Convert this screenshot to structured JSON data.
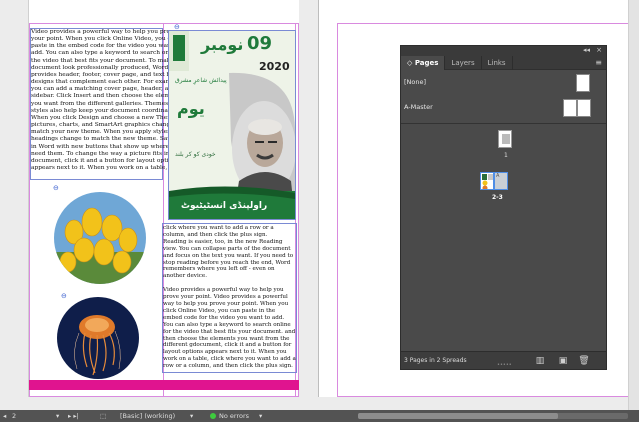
{
  "document": {
    "column1_text": "Video provides a powerful way to help you prove your point. When you click Online Video, you can paste in the embed code for the video you want to add. You can also type a keyword to search online for the video that best fits your document. To make your document look professionally produced, Word provides header, footer, cover page, and text box designs that complement each other. For example, you can add a matching cover page, header, and sidebar. Click Insert and then choose the elements you want from the different galleries. Themes and styles also help keep your document coordinated. When you click Design and choose a new Theme, the pictures, charts, and SmartArt graphics change to match your new theme. When you apply styles, your headings change to match the new theme. Save time in Word with new buttons that show up where you need them. To change the way a picture fits in your document, click it and a button for layout options appears next to it. When you work on a table,",
    "column2_text_1": "click where you want to add a row or a column, and then click the plus sign.",
    "column2_text_2": "Reading is easier, too, in the new Reading view. You can collapse parts of the document and focus on the text you want. If you need to stop reading before you reach the end, Word remembers where you left off - even on another device.",
    "column2_text_3": "Video provides a powerful way to help you prove your point. Video provides a powerful way to help you prove your point. When you click Online Video, you can paste in the embed code for the video you want to add. You can also type a keyword to search online for the video that best fits your document. and then choose the elements you want from the different gdocument, click it and a button for layout options appears next to it. When you work on a table, click where you want to add a row or a column, and then click the plus sign."
  },
  "poster": {
    "date_number": "09",
    "month_urdu": "نومبر",
    "year": "2020",
    "subtitle_urdu": "یوم",
    "line_urdu_1": "پیدائش شاعرِ مشرق",
    "line_urdu_2": "خودی کو کر بلند",
    "footer_urdu": "راولپنڈی انسٹیٹیوٹ",
    "colors": {
      "green": "#1f7a3a",
      "dark_green": "#155a28",
      "pale": "#eef3e8"
    }
  },
  "pages_panel": {
    "collapse_glyph": "◂◂",
    "close_glyph": "×",
    "tabs": [
      {
        "label": "Pages",
        "icon": "pages-tab-icon"
      },
      {
        "label": "Layers"
      },
      {
        "label": "Links"
      }
    ],
    "menu_glyph": "≡",
    "masters": [
      {
        "label": "[None]"
      },
      {
        "label": "A-Master"
      }
    ],
    "pages": [
      {
        "number_label": "1"
      },
      {
        "number_label": "2-3",
        "selected": true
      }
    ],
    "spread_count": "3 Pages in 2 Spreads",
    "bottom_buttons": [
      {
        "name": "edit-page-size-button",
        "glyph": "▥"
      },
      {
        "name": "new-page-button",
        "glyph": "▣"
      },
      {
        "name": "delete-page-button",
        "glyph": "🗑"
      }
    ],
    "resize_glyph": "•••••"
  },
  "status_bar": {
    "page_arrow": "◂",
    "page_number": "2",
    "page_dropdown": "▾",
    "nav_arrows": "▸ ▸|",
    "page_icon_glyph": "⬚",
    "style_label": "[Basic] (working)",
    "style_dropdown": "▾",
    "preflight_status": "No errors",
    "preflight_dropdown": "▾"
  }
}
